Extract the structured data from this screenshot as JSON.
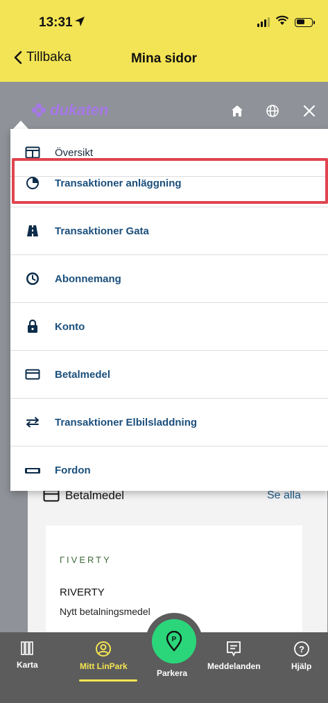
{
  "status": {
    "time": "13:31"
  },
  "nav": {
    "back_label": "Tillbaka",
    "title": "Mina sidor"
  },
  "header": {
    "logo_text": "dukaten",
    "logo_color": "#a678e8"
  },
  "menu": {
    "items": [
      {
        "label": "Översikt",
        "icon": "overview-icon"
      },
      {
        "label": "Transaktioner anläggning",
        "icon": "pie-chart-icon",
        "highlighted": true
      },
      {
        "label": "Transaktioner Gata",
        "icon": "road-icon"
      },
      {
        "label": "Abonnemang",
        "icon": "clock-icon"
      },
      {
        "label": "Konto",
        "icon": "lock-icon"
      },
      {
        "label": "Betalmedel",
        "icon": "credit-card-icon"
      },
      {
        "label": "Transaktioner Elbilsladdning",
        "icon": "transfer-icon"
      },
      {
        "label": "Fordon",
        "icon": "vehicle-icon"
      }
    ],
    "highlight_color": "#e0454f"
  },
  "content": {
    "section_title": "Betalmedel",
    "see_all": "Se alla",
    "payment": {
      "logo": "ГIVERTY",
      "name": "RIVERTY",
      "subtitle": "Nytt betalningsmedel"
    }
  },
  "tabbar": {
    "tabs": [
      {
        "label": "Karta",
        "icon": "map-icon"
      },
      {
        "label": "Mitt LinPark",
        "icon": "user-icon",
        "active": true
      },
      {
        "label": "Parkera",
        "icon": "parking-pin-icon"
      },
      {
        "label": "Meddelanden",
        "icon": "message-icon"
      },
      {
        "label": "Hjälp",
        "icon": "help-icon"
      }
    ],
    "accent": "#f5e552",
    "park_color": "#2bd67b"
  }
}
